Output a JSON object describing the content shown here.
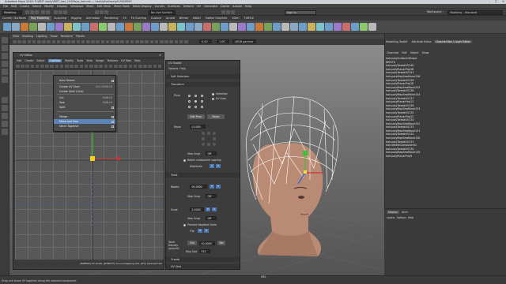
{
  "app": {
    "title": "Autodesk Maya 2018: E:\\MDT study\\MDT_hair_UV\\Maya_hair.mb  ---  hairUpSurface\\pCUV\\DEMO",
    "window_controls": [
      "–",
      "□",
      "✕"
    ]
  },
  "menubar": [
    "File",
    "Edit",
    "Create",
    "Select",
    "Modify",
    "Display",
    "Windows",
    "Mesh",
    "Edit Mesh",
    "Mesh Tools",
    "Mesh Display",
    "Curves",
    "Surfaces",
    "Deform",
    "UV",
    "Generate",
    "Cache",
    "Arnold",
    "Help"
  ],
  "workspace": {
    "label": "Workspace :",
    "value": "Modeling - Standard"
  },
  "status": {
    "mode": "Modeling",
    "surface_field": "No Live Surface",
    "sign_in": "Sign In"
  },
  "shelf_tabs": [
    "Curves / Surfaces",
    "Poly Modeling",
    "Sculpting",
    "Rigging",
    "Animation",
    "Rendering",
    "FX",
    "FX Caching",
    "Custom",
    "Arnold",
    "Bifrost",
    "MASH",
    "Motion Graphics",
    "XGen",
    "TURTLE"
  ],
  "shelf_active": "Poly Modeling",
  "viewport_menu": [
    "View",
    "Shading",
    "Lighting",
    "Show",
    "Renderer",
    "Panels"
  ],
  "viewport_fields": {
    "value1": "0.00",
    "value2": "1.00",
    "colorspace": "sRGB gamma"
  },
  "channel_box": {
    "tabs": [
      "Modelling Toolkit",
      "Attribute Editor",
      "Channel Box / Layer Editor"
    ],
    "menu": [
      "Channels",
      "Edit",
      "Object",
      "Show"
    ],
    "shape": "hair:polySurface1Shape",
    "inputs_label": "INPUTS",
    "inputs": [
      "hair:polyTweakUV140",
      "hair:polyPlanarProj16",
      "hair:polyTweakUV141",
      "hair:polyMapSewMove156",
      "hair:polyTweakUV139",
      "hair:polyPlanarProj18",
      "hair:polyMapSewMove155",
      "hair:polyTweakUV138",
      "hair:polyMapSewMove154",
      "hair:polyTweakUV137",
      "hair:polyPlanarProj13",
      "hair:polyTweakUV136",
      "hair:polyMapSewMove153",
      "hair:polyTweakUV135",
      "hair:polyPlanarProj12",
      "hair:polyTweakUV134",
      "hair:polyMapSewMove152",
      "hair:polyTweakUV133",
      "hair:polyMapSewMove151",
      "hair:polyTweakUV132",
      "hair:polyMapSewMove150",
      "hair:polyTweakUV131",
      "hair:deleteComponent1",
      "hair:polyTweakUV130",
      "hair:polyMapSewMove149",
      "hair:polyPlanarProj9"
    ]
  },
  "layer_editor": {
    "tabs": [
      "Display",
      "Anim"
    ],
    "menu": [
      "Layers",
      "Options",
      "Help"
    ]
  },
  "uv_editor": {
    "title": "UV Editor",
    "menu": [
      "Edit",
      "Create",
      "Select",
      "Cut/Sew",
      "Modify",
      "Tools",
      "View",
      "Image",
      "Textures",
      "UV Sets",
      "Help"
    ],
    "active_menu": "Cut/Sew",
    "status": "[EMERIA] UV shells, [DTNOT7] non-overlapping UVs, [0%] reversed UVs"
  },
  "cutsew_menu": {
    "items": [
      {
        "label": "Auto Seams",
        "shortcut": "",
        "box": true
      },
      {
        "label": "Create UV Shell",
        "shortcut": "Ctrl+Shift+X",
        "box": false
      },
      {
        "label": "Create Shell (Grid)",
        "shortcut": "",
        "box": false
      },
      {
        "label": "Cut",
        "shortcut": "Shift+X",
        "box": false
      },
      {
        "label": "Sew",
        "shortcut": "Shift+S",
        "box": false
      },
      {
        "label": "Split",
        "shortcut": "",
        "box": true
      },
      {
        "label": "Merge",
        "shortcut": "",
        "box": true
      },
      {
        "label": "Move and Sew",
        "shortcut": "",
        "box": true
      },
      {
        "label": "Stitch Together",
        "shortcut": "",
        "box": true
      }
    ],
    "highlighted": "Move and Sew"
  },
  "uv_toolkit": {
    "title": "UV Toolkit",
    "menu": [
      "Options",
      "Help"
    ],
    "sections": {
      "soft_selection": "Soft Selection",
      "transform": "Transform",
      "tools": "Tools",
      "create": "Create",
      "uv_sets": "UV Sets"
    },
    "pivot_label": "Pivot",
    "pivot_options": [
      "Selection",
      "UV Area"
    ],
    "pivot_buttons": [
      "Edit Pivot",
      "Reset"
    ],
    "move_label": "Move",
    "move_value": "0.1000",
    "step_snap_label": "Step Snap",
    "step_snap_value": "Off",
    "retain_spacing": "Retain component spacing",
    "distribute_label": "Distribute",
    "rotate_label": "Rotate",
    "rotate_value": "90.0000",
    "scale_label": "Scale",
    "scale_value": "2.0000",
    "prevent_negative": "Prevent Negative Scale",
    "flip_label": "Flip",
    "texel_label": "Texel Density (px/unit)",
    "texel_value": "10.0000",
    "texel_button": "Get",
    "texel_set": "Set",
    "map_size_label": "Map Size",
    "map_size_value": "512"
  },
  "help_line": "Drag and move UV together along the selected component",
  "command_label": "MEL"
}
